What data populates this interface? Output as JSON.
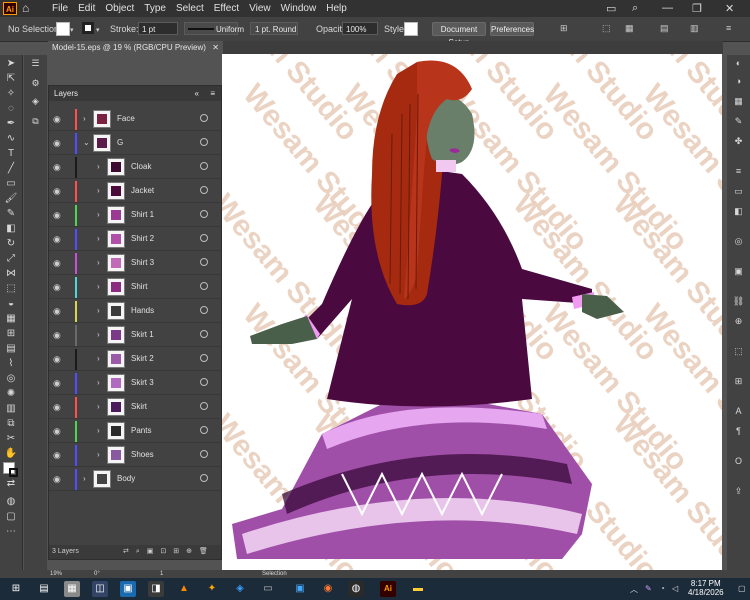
{
  "app": {
    "logo": "Ai"
  },
  "menu": [
    "File",
    "Edit",
    "Object",
    "Type",
    "Select",
    "Effect",
    "View",
    "Window",
    "Help"
  ],
  "window_controls": {
    "minimize": "—",
    "restore": "❐",
    "close": "✕"
  },
  "control_bar": {
    "selection": "No Selection",
    "stroke_label": "Stroke:",
    "stroke_value": "1 pt",
    "profile": "Uniform",
    "brush": "1 pt. Round",
    "opacity_label": "Opacity:",
    "opacity_value": "100%",
    "style_label": "Style:",
    "document_setup": "Document Setup",
    "preferences": "Preferences"
  },
  "document_tab": {
    "title": "Model-15.eps @ 19 % (RGB/CPU Preview)",
    "close": "✕"
  },
  "layers_panel": {
    "title": "Layers",
    "collapse": "«",
    "menu": "≡",
    "layers": [
      {
        "name": "Face",
        "color": "#ff4f4f",
        "indent": 0,
        "expanded": false,
        "thumb": "#7a2040"
      },
      {
        "name": "G",
        "color": "#4f4fff",
        "indent": 0,
        "expanded": true,
        "thumb": "#5c1a4a"
      },
      {
        "name": "Cloak",
        "color": "#1a1a1a",
        "indent": 1,
        "expanded": false,
        "thumb": "#3a0a30"
      },
      {
        "name": "Jacket",
        "color": "#ff4f4f",
        "indent": 1,
        "expanded": false,
        "thumb": "#4a0a3a"
      },
      {
        "name": "Shirt 1",
        "color": "#4fd64f",
        "indent": 1,
        "expanded": false,
        "thumb": "#9b3a92"
      },
      {
        "name": "Shirt 2",
        "color": "#4f4fff",
        "indent": 1,
        "expanded": false,
        "thumb": "#b04fa8"
      },
      {
        "name": "Shirt 3",
        "color": "#c84fd6",
        "indent": 1,
        "expanded": false,
        "thumb": "#c06ab8"
      },
      {
        "name": "Shirt",
        "color": "#4fd6d6",
        "indent": 1,
        "expanded": false,
        "thumb": "#8a2d80"
      },
      {
        "name": "Hands",
        "color": "#d6d64f",
        "indent": 1,
        "expanded": false,
        "thumb": "#3a3a3a"
      },
      {
        "name": "Skirt 1",
        "color": "#6a6a6a",
        "indent": 1,
        "expanded": false,
        "thumb": "#7a3a88"
      },
      {
        "name": "Skirt 2",
        "color": "#1a1a1a",
        "indent": 1,
        "expanded": false,
        "thumb": "#9a5aa8"
      },
      {
        "name": "Skirt 3",
        "color": "#4f4fff",
        "indent": 1,
        "expanded": false,
        "thumb": "#b06ac0"
      },
      {
        "name": "Skirt",
        "color": "#ff4f4f",
        "indent": 1,
        "expanded": false,
        "thumb": "#4a1a5a"
      },
      {
        "name": "Pants",
        "color": "#4fd64f",
        "indent": 1,
        "expanded": false,
        "thumb": "#2a2a2a"
      },
      {
        "name": "Shoes",
        "color": "#4f4fff",
        "indent": 1,
        "expanded": false,
        "thumb": "#8a5aa0"
      },
      {
        "name": "Body",
        "color": "#4f4fff",
        "indent": 0,
        "expanded": false,
        "thumb": "#444444"
      }
    ],
    "footer": "3 Layers"
  },
  "watermark": "Wesam Studio",
  "status_bar": {
    "zoom": "19%",
    "rotation": "0°",
    "artboard": "1",
    "tool": "Selection"
  },
  "taskbar": {
    "time": "8:17 PM",
    "date": "4/18/2026"
  }
}
